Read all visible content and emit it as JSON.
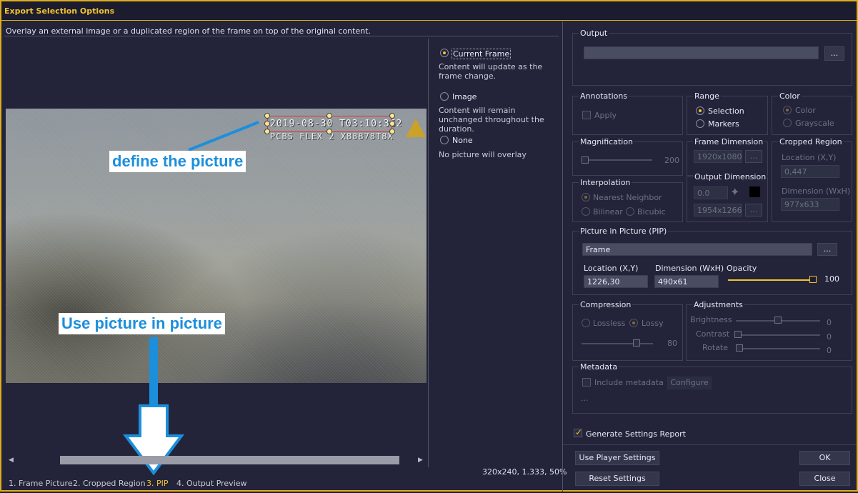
{
  "window": {
    "title": "Export Selection Options"
  },
  "description": "Overlay an external image or a duplicated region of the frame on top of the original content.",
  "preview": {
    "osd_line1": "2019-08-30 T03:10:362",
    "osd_line2": "PCBS FLEX 2 X88878T8X"
  },
  "callouts": {
    "define": "define the picture",
    "use_pip": "Use picture in picture"
  },
  "source_options": [
    {
      "label": "Current Frame",
      "selected": true,
      "desc": "Content will update as the frame change."
    },
    {
      "label": "Image",
      "selected": false,
      "desc": "Content will remain unchanged throughout the duration."
    },
    {
      "label": "None",
      "selected": false,
      "desc": "No picture will overlay"
    }
  ],
  "tabs": [
    "1. Frame Picture",
    "2. Cropped Region",
    "3. PIP",
    "4. Output Preview"
  ],
  "active_tab": "3. PIP",
  "status": "320x240, 1.333, 50%",
  "output": {
    "title": "Output",
    "browse": "..."
  },
  "annotations": {
    "title": "Annotations",
    "apply": "Apply"
  },
  "range": {
    "title": "Range",
    "selection": "Selection",
    "markers": "Markers"
  },
  "color": {
    "title": "Color",
    "color": "Color",
    "grayscale": "Grayscale"
  },
  "magnification": {
    "title": "Magnification",
    "value": "200"
  },
  "frame_dimension": {
    "title": "Frame Dimension",
    "value": "1920x1080",
    "browse": "..."
  },
  "cropped_region": {
    "title": "Cropped Region",
    "loc_label": "Location (X,Y)",
    "loc_value": "0,447",
    "dim_label": "Dimension (WxH)",
    "dim_value": "977x633"
  },
  "interpolation": {
    "title": "Interpolation",
    "nearest": "Nearest Neighbor",
    "bilinear": "Bilinear",
    "bicubic": "Bicubic"
  },
  "output_dimension": {
    "title": "Output Dimension",
    "ratio": "0.0",
    "value": "1954x1266",
    "browse": "..."
  },
  "pip": {
    "title": "Picture in Picture (PIP)",
    "source": "Frame",
    "browse": "...",
    "loc_label": "Location (X,Y)",
    "loc_value": "1226,30",
    "dim_label": "Dimension (WxH)",
    "dim_value": "490x61",
    "opacity_label": "Opacity",
    "opacity_value": "100",
    "opacity_level": 1.0
  },
  "compression": {
    "title": "Compression",
    "lossless": "Lossless",
    "lossy": "Lossy",
    "quality": "80"
  },
  "adjustments": {
    "title": "Adjustments",
    "brightness": "Brightness",
    "brightness_value": "0",
    "contrast": "Contrast",
    "contrast_value": "0",
    "rotate": "Rotate",
    "rotate_value": "0"
  },
  "metadata": {
    "title": "Metadata",
    "include": "Include metadata",
    "configure": "Configure",
    "ellipsis": "..."
  },
  "report": {
    "label": "Generate Settings Report",
    "checked": true
  },
  "buttons": {
    "use_player": "Use Player Settings",
    "reset": "Reset Settings",
    "ok": "OK",
    "close": "Close"
  },
  "colors": {
    "accent": "#f2c230",
    "border": "#e0ae1c",
    "callout_text": "#1c8fdc"
  }
}
